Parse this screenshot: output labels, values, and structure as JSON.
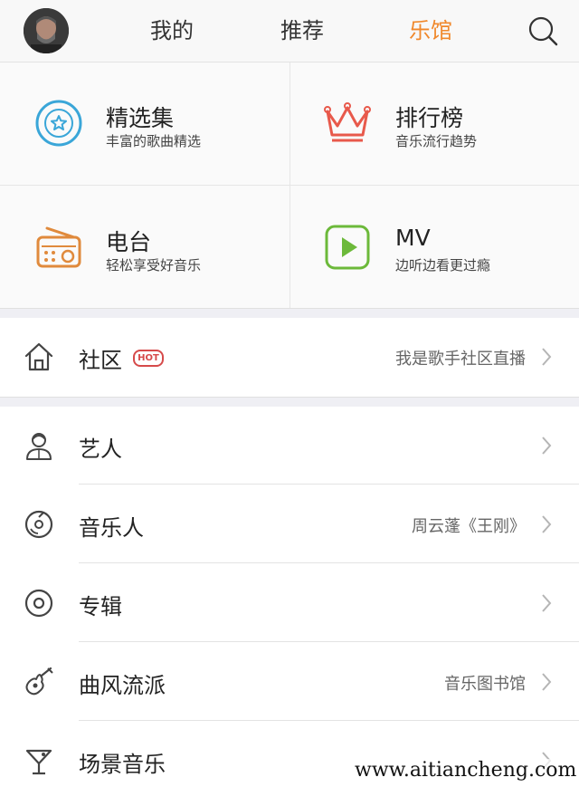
{
  "tabs": {
    "mine": "我的",
    "recommend": "推荐",
    "music_hall": "乐馆",
    "active_color": "#f0882b"
  },
  "grid": {
    "featured": {
      "title": "精选集",
      "subtitle": "丰富的歌曲精选",
      "icon": "star-circle-icon",
      "color": "#3aa6d8"
    },
    "charts": {
      "title": "排行榜",
      "subtitle": "音乐流行趋势",
      "icon": "crown-icon",
      "color": "#e8594b"
    },
    "radio": {
      "title": "电台",
      "subtitle": "轻松享受好音乐",
      "icon": "radio-icon",
      "color": "#e08a3c"
    },
    "mv": {
      "title": "MV",
      "subtitle": "边听边看更过瘾",
      "icon": "play-square-icon",
      "color": "#6cb93a"
    }
  },
  "community": {
    "label": "社区",
    "badge": "HOT",
    "value": "我是歌手社区直播"
  },
  "list": {
    "artists": {
      "label": "艺人",
      "value": ""
    },
    "musicians": {
      "label": "音乐人",
      "value": "周云蓬《王刚》"
    },
    "albums": {
      "label": "专辑",
      "value": ""
    },
    "genres": {
      "label": "曲风流派",
      "value": "音乐图书馆"
    },
    "scenes": {
      "label": "场景音乐",
      "value": ""
    }
  },
  "watermark": "www.aitiancheng.com"
}
